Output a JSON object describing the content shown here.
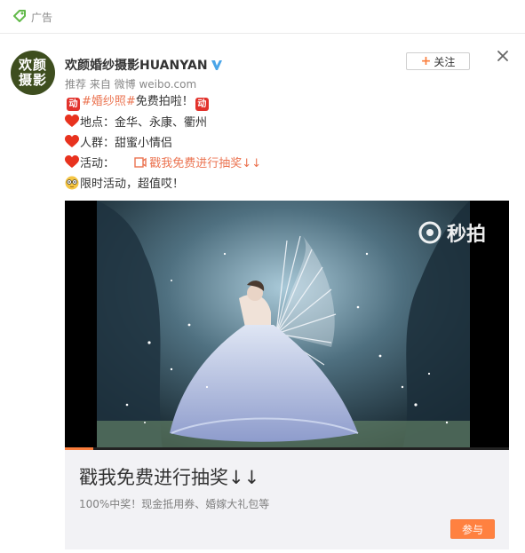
{
  "topbar": {
    "ad_label": "广告",
    "ad_icon": "ad-tag-icon",
    "accent": "#62b94a"
  },
  "post": {
    "avatar_text": "欢颜\n摄影",
    "username": "欢颜婚纱摄影HUANYAN",
    "verified_icon": "verified-v-icon",
    "meta": "推荐 来自 微博 weibo.com",
    "follow": {
      "plus": "+",
      "label": "关注"
    },
    "close_icon": "close-icon",
    "lines": {
      "l1_brand_left": "动",
      "l1_hashtag": "#婚纱照#",
      "l1_text": "免费拍啦！",
      "l1_brand_right": "动",
      "l2": "地点：金华、永康、衢州",
      "l3": "人群：甜蜜小情侣",
      "l4_label": "活动：",
      "l4_link": "戳我免费进行抽奖↓↓",
      "l5": "限时活动，超值哎！"
    },
    "icons": {
      "heart": "heart-icon",
      "face": "emoji-face-icon",
      "link": "link-icon",
      "brand": "brand-badge-icon"
    }
  },
  "video": {
    "watermark": "秒拍",
    "watermark_icon": "miaopai-logo-icon",
    "progress": 0.064
  },
  "promo": {
    "title": "戳我免费进行抽奖↓↓",
    "subtitle": "100%中奖！现金抵用券、婚嫁大礼包等",
    "button": "参与"
  },
  "colors": {
    "accent_orange": "#fa7d3c",
    "link": "#eb7350",
    "avatar_bg": "#3e4e1f",
    "verified": "#4aa5e8"
  }
}
